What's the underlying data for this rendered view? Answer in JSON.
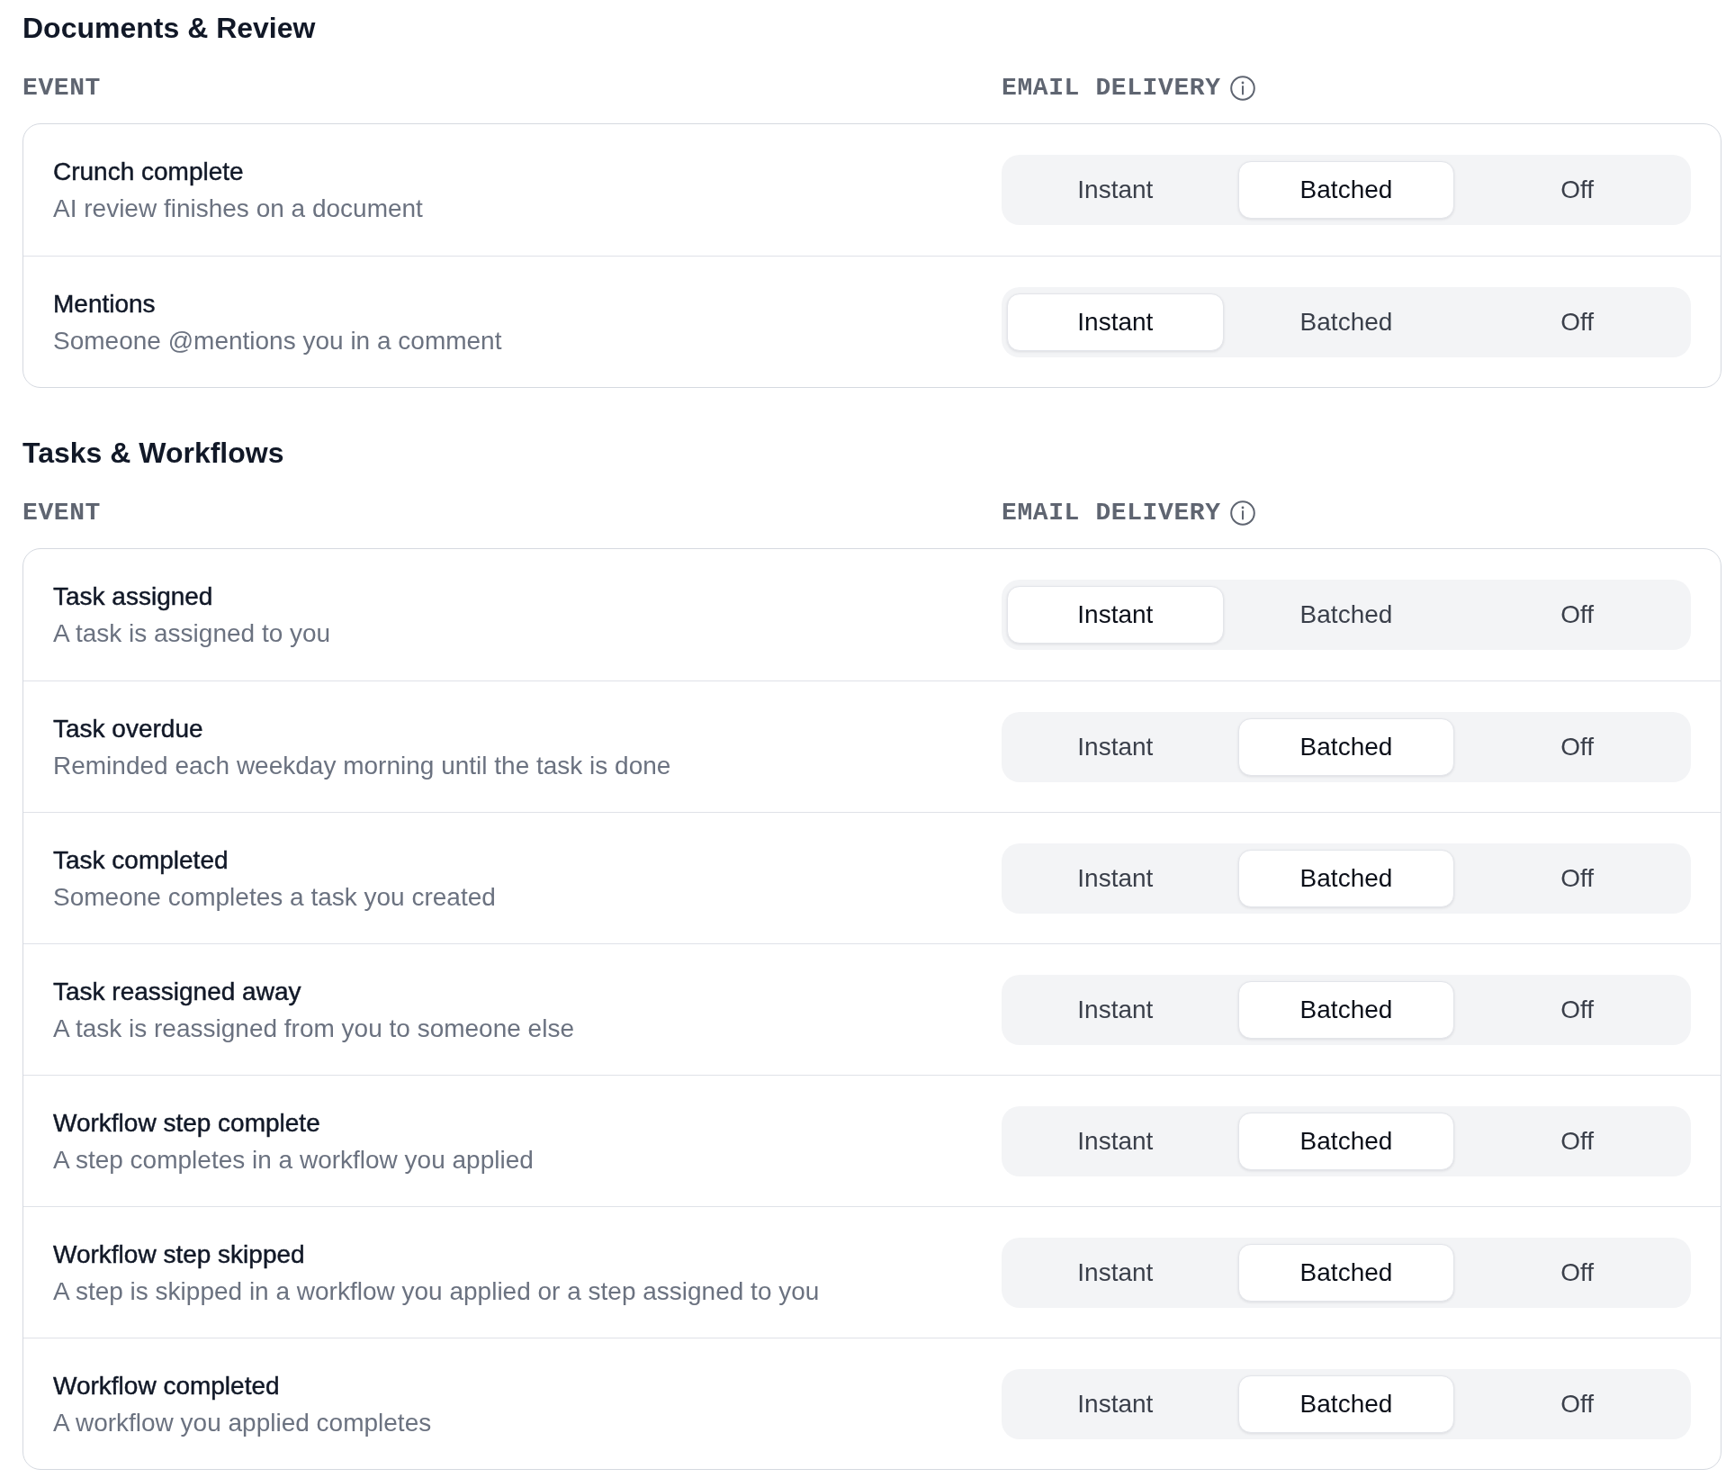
{
  "sections": [
    {
      "title": "Documents & Review",
      "columns": [
        "EVENT",
        "EMAIL DELIVERY"
      ],
      "events": [
        {
          "title": "Crunch complete",
          "description": "AI review finishes on a document",
          "options": [
            {
              "label": "Instant",
              "selected": false
            },
            {
              "label": "Batched",
              "selected": true
            },
            {
              "label": "Off",
              "selected": false
            }
          ]
        },
        {
          "title": "Mentions",
          "description": "Someone @mentions you in a comment",
          "options": [
            {
              "label": "Instant",
              "selected": true
            },
            {
              "label": "Batched",
              "selected": false
            },
            {
              "label": "Off",
              "selected": false
            }
          ]
        }
      ]
    },
    {
      "title": "Tasks & Workflows",
      "columns": [
        "EVENT",
        "EMAIL DELIVERY"
      ],
      "events": [
        {
          "title": "Task assigned",
          "description": "A task is assigned to you",
          "options": [
            {
              "label": "Instant",
              "selected": true
            },
            {
              "label": "Batched",
              "selected": false
            },
            {
              "label": "Off",
              "selected": false
            }
          ]
        },
        {
          "title": "Task overdue",
          "description": "Reminded each weekday morning until the task is done",
          "options": [
            {
              "label": "Instant",
              "selected": false
            },
            {
              "label": "Batched",
              "selected": true
            },
            {
              "label": "Off",
              "selected": false
            }
          ]
        },
        {
          "title": "Task completed",
          "description": "Someone completes a task you created",
          "options": [
            {
              "label": "Instant",
              "selected": false
            },
            {
              "label": "Batched",
              "selected": true
            },
            {
              "label": "Off",
              "selected": false
            }
          ]
        },
        {
          "title": "Task reassigned away",
          "description": "A task is reassigned from you to someone else",
          "options": [
            {
              "label": "Instant",
              "selected": false
            },
            {
              "label": "Batched",
              "selected": true
            },
            {
              "label": "Off",
              "selected": false
            }
          ]
        },
        {
          "title": "Workflow step complete",
          "description": "A step completes in a workflow you applied",
          "options": [
            {
              "label": "Instant",
              "selected": false
            },
            {
              "label": "Batched",
              "selected": true
            },
            {
              "label": "Off",
              "selected": false
            }
          ]
        },
        {
          "title": "Workflow step skipped",
          "description": "A step is skipped in a workflow you applied or a step assigned to you",
          "options": [
            {
              "label": "Instant",
              "selected": false
            },
            {
              "label": "Batched",
              "selected": true
            },
            {
              "label": "Off",
              "selected": false
            }
          ]
        },
        {
          "title": "Workflow completed",
          "description": "A workflow you applied completes",
          "options": [
            {
              "label": "Instant",
              "selected": false
            },
            {
              "label": "Batched",
              "selected": true
            },
            {
              "label": "Off",
              "selected": false
            }
          ]
        }
      ]
    }
  ]
}
